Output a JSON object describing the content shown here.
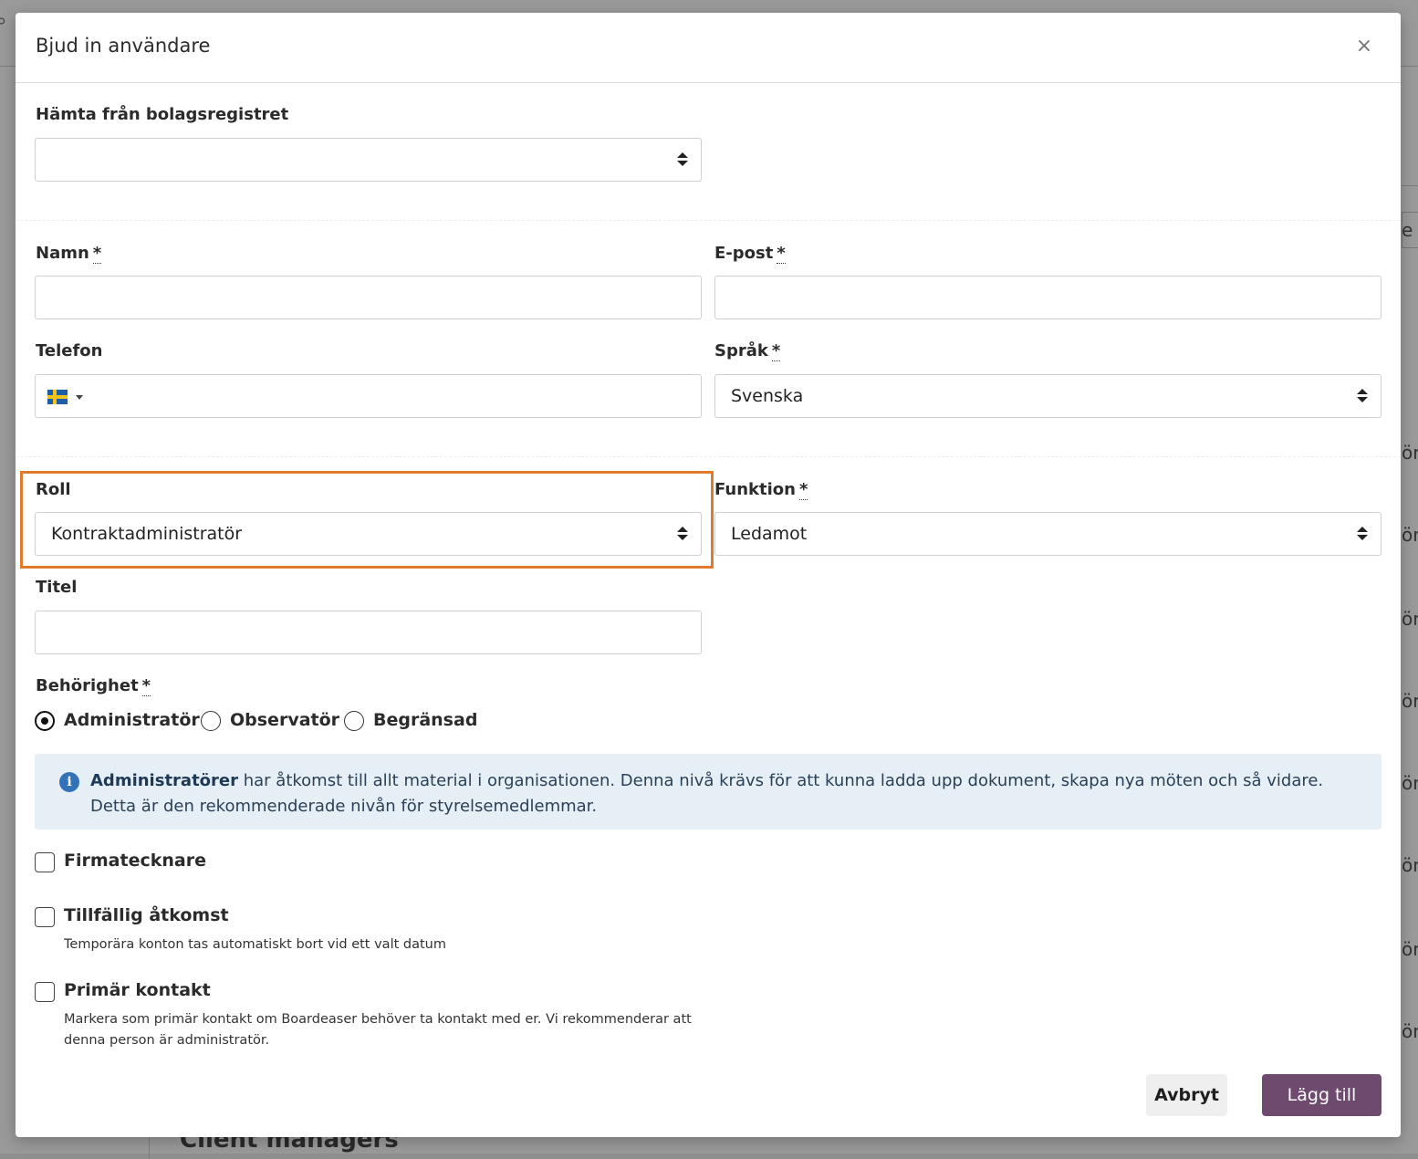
{
  "background": {
    "section_heading": "Client managers",
    "edge_fragments": [
      "e",
      "ör",
      "ör",
      "ör",
      "ör",
      "ör",
      "ör",
      "ör",
      "ör"
    ]
  },
  "modal": {
    "title": "Bjud in användare",
    "close_label": "×"
  },
  "form": {
    "registry": {
      "label": "Hämta från bolagsregistret",
      "value": ""
    },
    "name": {
      "label": "Namn",
      "required_mark": "*",
      "value": ""
    },
    "email": {
      "label": "E-post",
      "required_mark": "*",
      "value": ""
    },
    "phone": {
      "label": "Telefon",
      "value": "",
      "country_flag": "sweden-flag-icon"
    },
    "language": {
      "label": "Språk",
      "required_mark": "*",
      "value": "Svenska"
    },
    "role": {
      "label": "Roll",
      "value": "Kontraktadministratör"
    },
    "function": {
      "label": "Funktion",
      "required_mark": "*",
      "value": "Ledamot"
    },
    "title_field": {
      "label": "Titel",
      "value": ""
    },
    "permission": {
      "label": "Behörighet",
      "required_mark": "*",
      "options": [
        {
          "label": "Administratör",
          "checked": true
        },
        {
          "label": "Observatör",
          "checked": false
        },
        {
          "label": "Begränsad",
          "checked": false
        }
      ]
    },
    "info": {
      "bold": "Administratörer",
      "text": " har åtkomst till allt material i organisationen. Denna nivå krävs för att kunna ladda upp dokument, skapa nya möten och så vidare. Detta är den rekommenderade nivån för styrelsemedlemmar."
    },
    "signatory": {
      "label": "Firmatecknare",
      "checked": false
    },
    "temporary": {
      "label": "Tillfällig åtkomst",
      "help": "Temporära konton tas automatiskt bort vid ett valt datum",
      "checked": false
    },
    "primary_contact": {
      "label": "Primär kontakt",
      "help": "Markera som primär kontakt om Boardeaser behöver ta kontakt med er. Vi rekommenderar att denna person är administratör.",
      "checked": false
    }
  },
  "buttons": {
    "cancel": "Avbryt",
    "submit": "Lägg till"
  },
  "colors": {
    "highlight": "#e07a2e",
    "primary_button": "#6e4a6e",
    "info_background": "#e6eef6",
    "info_icon": "#3472b8"
  }
}
